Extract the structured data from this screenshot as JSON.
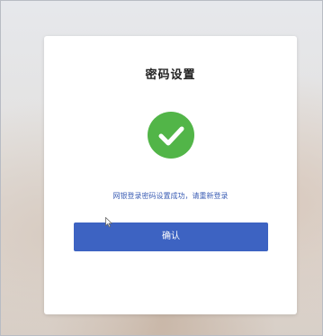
{
  "dialog": {
    "title": "密码设置",
    "message": "网银登录密码设置成功，请重新登录",
    "confirm_label": "确认"
  },
  "colors": {
    "success": "#52b548",
    "primary": "#3d63c2",
    "message_text": "#3d5fb5"
  },
  "icons": {
    "status": "check-circle-icon"
  }
}
